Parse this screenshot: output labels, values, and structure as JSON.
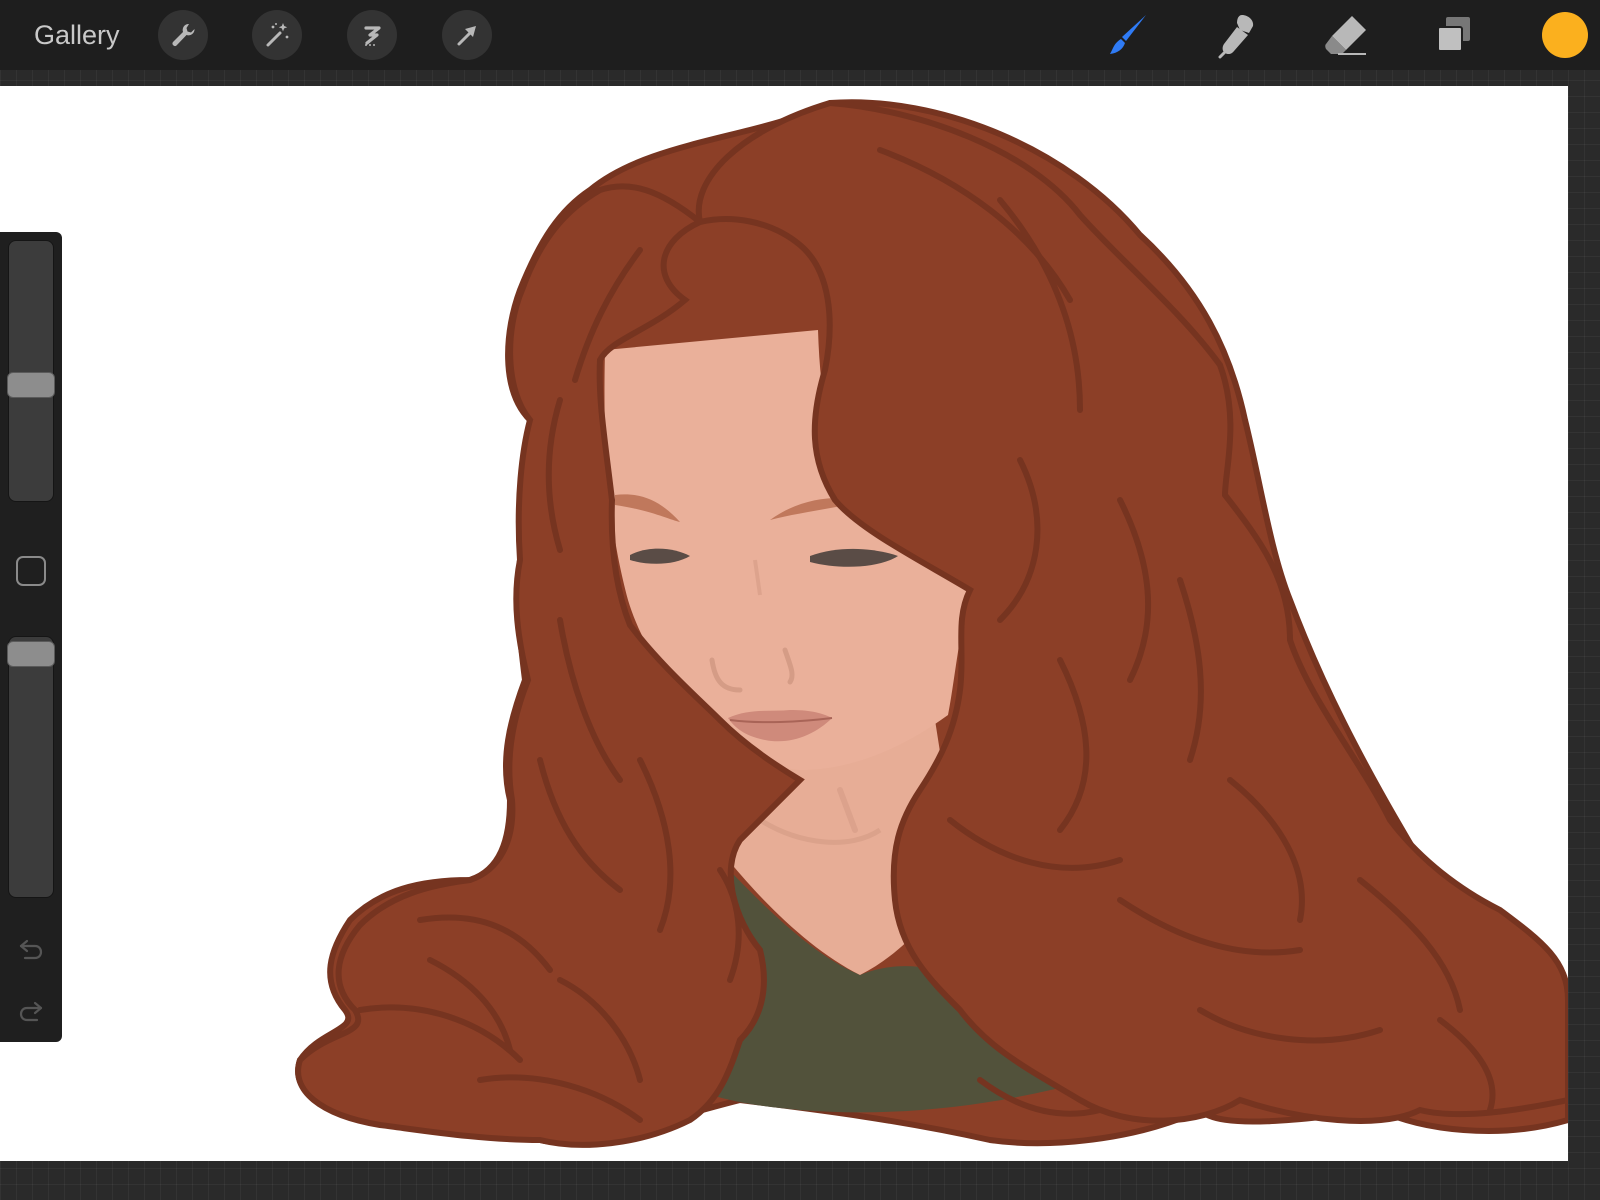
{
  "toolbar": {
    "gallery_label": "Gallery",
    "left_tools": [
      {
        "name": "actions",
        "icon": "wrench-icon"
      },
      {
        "name": "adjustments",
        "icon": "magic-wand-icon"
      },
      {
        "name": "selection",
        "icon": "selection-s-icon"
      },
      {
        "name": "transform",
        "icon": "arrow-cursor-icon"
      }
    ],
    "right_tools": [
      {
        "name": "brush",
        "icon": "brush-icon",
        "active": true
      },
      {
        "name": "smudge",
        "icon": "smudge-icon",
        "active": false
      },
      {
        "name": "eraser",
        "icon": "eraser-icon",
        "active": false
      },
      {
        "name": "layers",
        "icon": "layers-icon",
        "active": false
      }
    ],
    "active_color": "#fbb01e",
    "active_tool_color": "#2f7bf5",
    "icon_color": "#b8b8b8"
  },
  "sidebar": {
    "brush_size_level": 0.44,
    "brush_opacity_level": 0.98,
    "controls": [
      "brush-size-slider",
      "modify-button",
      "brush-opacity-slider",
      "undo-button",
      "redo-button"
    ]
  },
  "artwork": {
    "subject": "illustration",
    "palette": {
      "hair": "#8c3f27",
      "hair_line": "#763420",
      "skin": "#eab09a",
      "skin_shadow": "#d59c86",
      "lips": "#cf8a7b",
      "eyelids": "#5a4c46",
      "eyebrows": "#c0785c",
      "shirt": "#52523b",
      "canvas_bg": "#ffffff"
    }
  }
}
